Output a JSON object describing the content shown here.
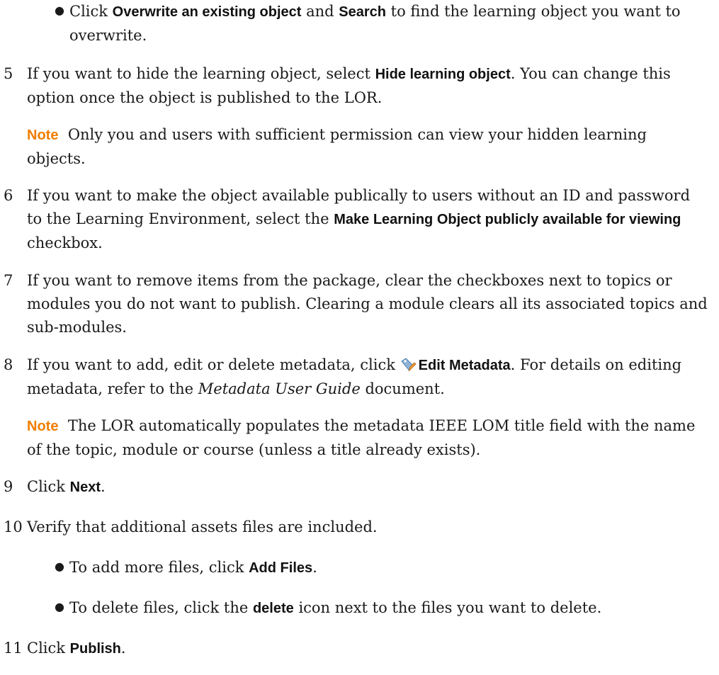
{
  "bullet_top": {
    "t1": "Click ",
    "b1": "Overwrite an existing object",
    "t2": " and ",
    "b2": "Search",
    "t3": " to find the learning object you want to overwrite."
  },
  "steps": [
    {
      "num": "5",
      "t1": "If you want to hide the learning object, select ",
      "b1": "Hide learning object",
      "t2": ". You can change this option once the object is published to the LOR."
    },
    {
      "num": "6",
      "t1": "If you want to make the object available publically to users without an ID and password to the Learning Environment, select the ",
      "b1": "Make Learning Object publicly available for viewing",
      "t2": " checkbox."
    },
    {
      "num": "7",
      "t1": "If you want to remove items from the package, clear the checkboxes next to topics or modules you do not want to publish. Clearing a module clears all its associated topics and sub-modules."
    },
    {
      "num": "8",
      "t1": "If you want to add, edit or delete metadata, click ",
      "b1": "Edit Metadata",
      "t2": ". For details on editing metadata, refer to the ",
      "i1": "Metadata User Guide",
      "t3": " document."
    },
    {
      "num": "9",
      "t1": "Click ",
      "b1": "Next",
      "t2": "."
    },
    {
      "num": "10",
      "t1": "Verify that additional assets files are included."
    },
    {
      "num": "11",
      "t1": "Click ",
      "b1": "Publish",
      "t2": "."
    }
  ],
  "notes": [
    {
      "label": "Note",
      "text": "Only you and users with sufficient permission can view your hidden learning objects."
    },
    {
      "label": "Note",
      "text": "The LOR automatically populates the metadata IEEE LOM title field with the name of the topic, module or course (unless a title already exists)."
    }
  ],
  "sub_bullets": [
    {
      "t1": "To add more files, click ",
      "b1": "Add Files",
      "t2": "."
    },
    {
      "t1": "To delete files, click the ",
      "b1": "delete",
      "t2": " icon next to the files you want to delete."
    }
  ],
  "icons": {
    "edit_metadata": "tag-pencil-icon"
  },
  "colors": {
    "note": "#f07d00",
    "text": "#1a1a1a"
  }
}
